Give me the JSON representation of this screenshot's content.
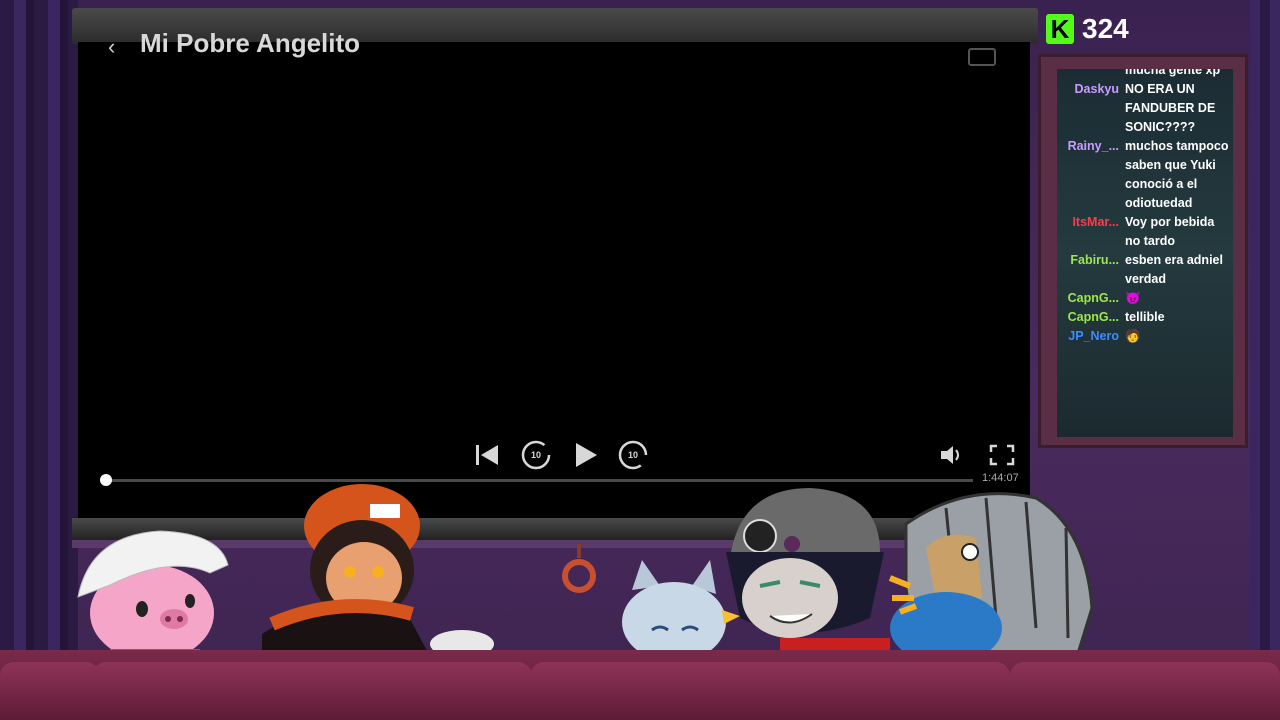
{
  "player": {
    "title": "Mi Pobre Angelito",
    "duration": "1:44:07",
    "progress": 0.0,
    "icons": [
      "back-icon",
      "subtitles-icon",
      "skip-previous-icon",
      "rewind-10-icon",
      "play-icon",
      "forward-10-icon",
      "volume-icon",
      "fullscreen-icon"
    ],
    "rewind_label": "10",
    "forward_label": "10"
  },
  "kick": {
    "logo": "K",
    "viewer_count": "324",
    "brand_color": "#53fc18"
  },
  "chat": {
    "messages": [
      {
        "user": "",
        "text": "mucha gente xp",
        "color": "#ffffff"
      },
      {
        "user": "Daskyu",
        "text": "NO ERA UN FANDUBER DE SONIC????",
        "color": "#c79cff"
      },
      {
        "user": "Rainy_...",
        "text": "muchos tampoco saben que Yuki conoció a el odiotuedad",
        "color": "#c79cff"
      },
      {
        "user": "ItsMar...",
        "text": "Voy por bebida no tardo",
        "color": "#ff3b4a"
      },
      {
        "user": "Fabiru...",
        "text": "esben era adniel verdad",
        "color": "#9be84e"
      },
      {
        "user": "CapnG...",
        "text": "😈",
        "color": "#9be84e"
      },
      {
        "user": "CapnG...",
        "text": "tellible",
        "color": "#9be84e"
      },
      {
        "user": "JP_Nero",
        "text": "🧑",
        "color": "#3b8cff"
      }
    ]
  }
}
